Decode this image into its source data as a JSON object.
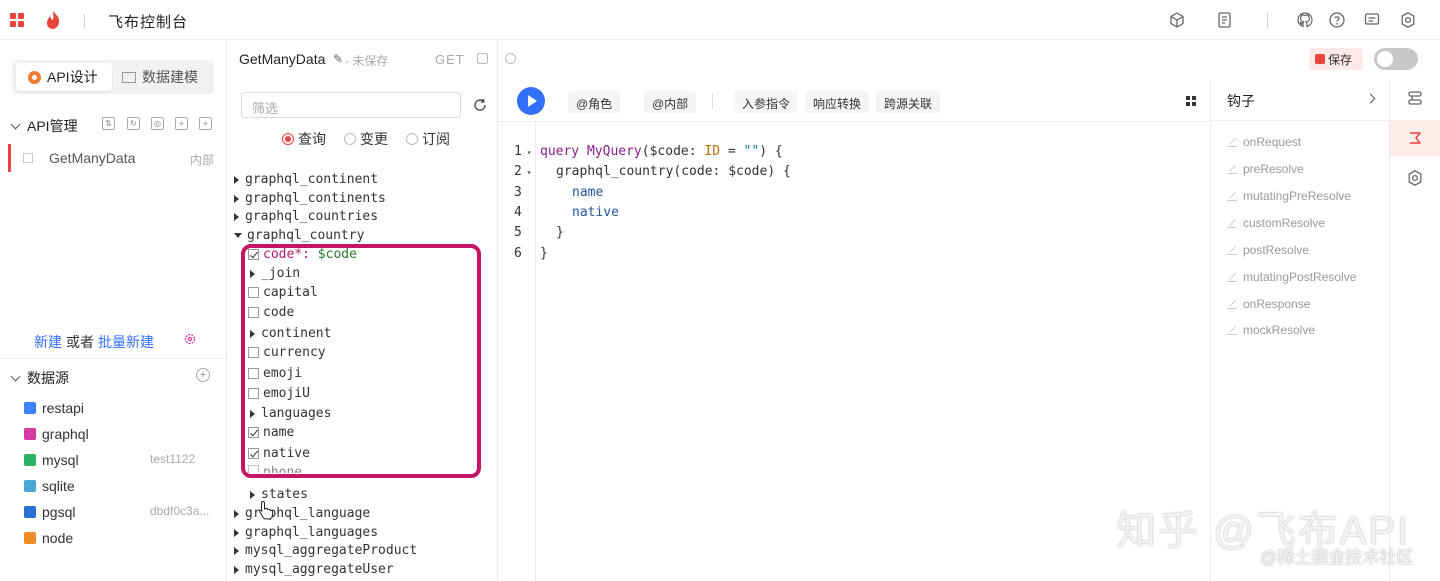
{
  "app": {
    "title": "飞布控制台"
  },
  "colors": {
    "brand": "#e8453c",
    "primary": "#3370ff",
    "highlight": "#c71566"
  },
  "sidebar": {
    "tab_api": "API设计",
    "tab_data": "数据建模",
    "api_section": "API管理",
    "api_item": {
      "name": "GetManyData",
      "tag": "内部"
    },
    "new_link": "新建",
    "or_text": "或者",
    "batch_link": "批量新建",
    "datasource_section": "数据源",
    "datasources": [
      {
        "name": "restapi",
        "color": "#3b82f6",
        "meta": ""
      },
      {
        "name": "graphql",
        "color": "#d63aa0",
        "meta": ""
      },
      {
        "name": "mysql",
        "color": "#28b463",
        "meta": "test1122"
      },
      {
        "name": "sqlite",
        "color": "#4aa8d8",
        "meta": ""
      },
      {
        "name": "pgsql",
        "color": "#2f6fd8",
        "meta": "dbdf0c3a..."
      },
      {
        "name": "node",
        "color": "#f08a24",
        "meta": ""
      }
    ]
  },
  "explorer": {
    "operation_name": "GetManyData",
    "unsaved": "- 未保存",
    "method": "GET",
    "filter_placeholder": "筛选",
    "radio_query": "查询",
    "radio_mutation": "变更",
    "radio_subscription": "订阅",
    "fields": {
      "continent": "graphql_continent",
      "continents": "graphql_continents",
      "countries": "graphql_countries",
      "country": "graphql_country",
      "code_arg": "code*:",
      "code_var": "$code",
      "join": "_join",
      "capital": "capital",
      "code": "code",
      "continent_sub": "continent",
      "currency": "currency",
      "emoji": "emoji",
      "emojiU": "emojiU",
      "languages": "languages",
      "name": "name",
      "native": "native",
      "phone": "phone",
      "states": "states",
      "language": "graphql_language",
      "languages_root": "graphql_languages",
      "agg_product": "mysql_aggregateProduct",
      "agg_user": "mysql_aggregateUser"
    }
  },
  "toolbar": {
    "role": "@角色",
    "internal": "@内部",
    "directives": "入参指令",
    "transform": "响应转换",
    "cors": "跨源关联"
  },
  "editor": {
    "line_numbers": [
      "1",
      "2",
      "3",
      "4",
      "5",
      "6"
    ],
    "l1_kw": "query",
    "l1_name": "MyQuery",
    "l1_var": "($code",
    "l1_type": "ID",
    "l1_str": "\"\"",
    "l1_rest": ") {",
    "l2_fn": "graphql_country",
    "l2_args": "(code: $code) {",
    "l3": "name",
    "l4": "native",
    "l5": "}",
    "l6": "}"
  },
  "header_actions": {
    "save": "保存"
  },
  "hooks": {
    "title": "钩子",
    "items": [
      "onRequest",
      "preResolve",
      "mutatingPreResolve",
      "customResolve",
      "postResolve",
      "mutatingPostResolve",
      "onResponse",
      "mockResolve"
    ]
  },
  "watermark": {
    "main": "知乎 @飞布API",
    "sub": "@稀土掘金技术社区"
  }
}
